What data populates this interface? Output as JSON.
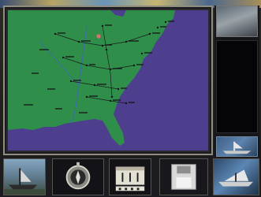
{
  "map": {
    "ocean_color": "#4d3e8e",
    "land_color": "#2f8f4a",
    "label_color": "#151515",
    "capital_marker_color": "#e07070"
  },
  "toolbar": {
    "icons": [
      "ship-icon",
      "compass-icon",
      "calendar-icon",
      "floppy-disk-icon",
      "ship-icon"
    ]
  },
  "rail": {
    "panels": [
      "portrait-panel",
      "info-panel",
      "ship-panel"
    ]
  }
}
